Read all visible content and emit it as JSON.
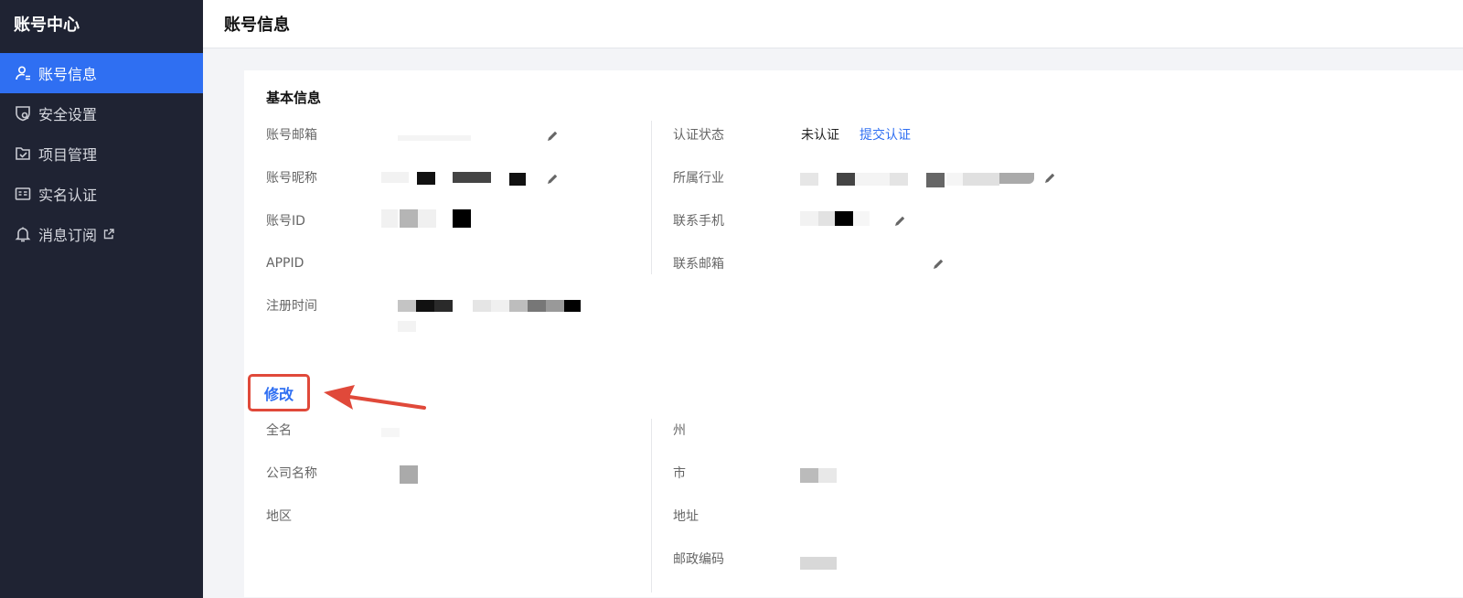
{
  "sidebar": {
    "title": "账号中心",
    "items": [
      {
        "label": "账号信息",
        "icon": "user-icon",
        "active": true
      },
      {
        "label": "安全设置",
        "icon": "shield-icon",
        "active": false
      },
      {
        "label": "项目管理",
        "icon": "folder-check-icon",
        "active": false
      },
      {
        "label": "实名认证",
        "icon": "id-card-icon",
        "active": false
      },
      {
        "label": "消息订阅",
        "icon": "bell-icon",
        "active": false,
        "external": true
      }
    ]
  },
  "header": {
    "title": "账号信息"
  },
  "basic": {
    "title": "基本信息",
    "left": {
      "email_label": "账号邮箱",
      "nickname_label": "账号昵称",
      "id_label": "账号ID",
      "appid_label": "APPID",
      "register_label": "注册时间"
    },
    "right": {
      "auth_label": "认证状态",
      "auth_value": "未认证",
      "auth_link": "提交认证",
      "industry_label": "所属行业",
      "phone_label": "联系手机",
      "contact_email_label": "联系邮箱"
    }
  },
  "company": {
    "edit_label": "修改",
    "left": {
      "fullname_label": "全名",
      "company_label": "公司名称",
      "region_label": "地区"
    },
    "right": {
      "state_label": "州",
      "city_label": "市",
      "address_label": "地址",
      "postcode_label": "邮政编码"
    }
  },
  "colors": {
    "accent": "#2f6ff2",
    "sidebar": "#1f2333",
    "annotation": "#e0493a"
  }
}
